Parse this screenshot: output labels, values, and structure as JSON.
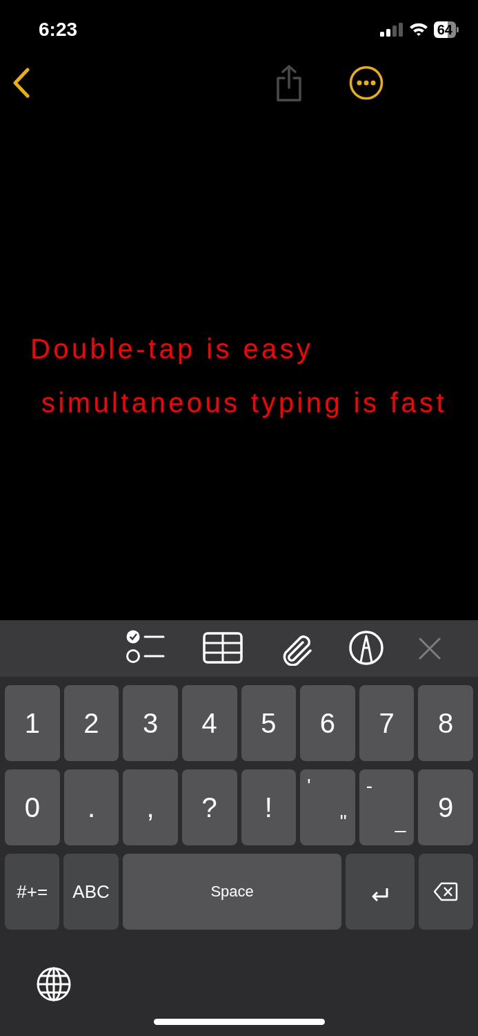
{
  "status_bar": {
    "time": "6:23",
    "battery": "64"
  },
  "note": {
    "lines": [
      "Double-tap is easy",
      "simultaneous typing is fast"
    ],
    "color": "#ff0000"
  },
  "keyboard": {
    "rows": [
      [
        {
          "kind": "single",
          "label": "1"
        },
        {
          "kind": "single",
          "label": "2"
        },
        {
          "kind": "single",
          "label": "3"
        },
        {
          "kind": "single",
          "label": "4"
        },
        {
          "kind": "single",
          "label": "5"
        },
        {
          "kind": "single",
          "label": "6"
        },
        {
          "kind": "single",
          "label": "7"
        },
        {
          "kind": "single",
          "label": "8"
        }
      ],
      [
        {
          "kind": "single",
          "label": "0"
        },
        {
          "kind": "single",
          "label": "."
        },
        {
          "kind": "single",
          "label": ","
        },
        {
          "kind": "single",
          "label": "?"
        },
        {
          "kind": "single",
          "label": "!"
        },
        {
          "kind": "dual",
          "top": "'",
          "bottom": "\""
        },
        {
          "kind": "dual",
          "top": "-",
          "bottom": "_"
        },
        {
          "kind": "single",
          "label": "9"
        }
      ],
      [
        {
          "kind": "function",
          "label": "#+="
        },
        {
          "kind": "function",
          "label": "ABC"
        },
        {
          "kind": "space",
          "label": "Space"
        },
        {
          "kind": "return"
        },
        {
          "kind": "delete"
        }
      ]
    ]
  }
}
